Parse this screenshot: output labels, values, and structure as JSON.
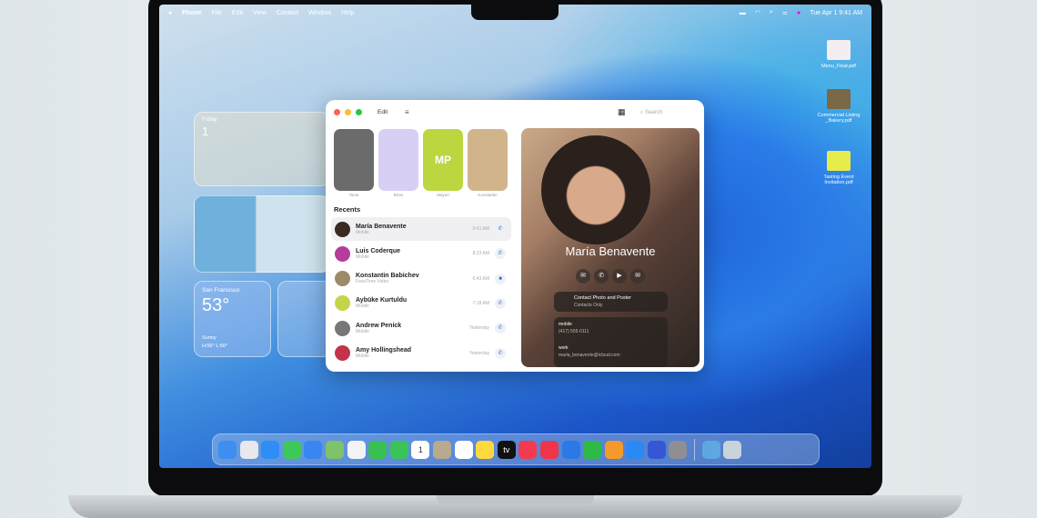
{
  "menubar": {
    "apple": "",
    "app": "Phone",
    "items": [
      "File",
      "Edit",
      "View",
      "Contact",
      "Window",
      "Help"
    ],
    "datetime": "Tue Apr 1  9:41 AM"
  },
  "widgets": {
    "calendar_day": "Friday",
    "calendar_date": "1",
    "weather_city": "San Francisco",
    "weather_temp": "53°",
    "weather_cond": "Sunny",
    "weather_range": "H:56° L:50°"
  },
  "desktop_files": [
    "Menu_Final.pdf",
    "Commercial Listing _Bakery.pdf",
    "Tasting Event Invitation.pdf"
  ],
  "phone": {
    "edit_label": "Edit",
    "search_placeholder": "Search",
    "favorites": [
      {
        "name": "Tania",
        "initials": "",
        "color": "#6b6b6b"
      },
      {
        "name": "Brian",
        "initials": "",
        "color": "#d9cff5"
      },
      {
        "name": "Mayuri",
        "initials": "MP",
        "color": "#bcd640"
      },
      {
        "name": "Konstantin",
        "initials": "",
        "color": "#d2b48c"
      }
    ],
    "recents_title": "Recents",
    "recents": [
      {
        "name": "María Benavente",
        "type": "Mobile",
        "time": "9:41 AM",
        "call": "phone",
        "color": "#3a2a22"
      },
      {
        "name": "Luis Coderque",
        "type": "Mobile",
        "time": "8:23 AM",
        "call": "phone",
        "color": "#b53d9a"
      },
      {
        "name": "Konstantin Babichev",
        "type": "FaceTime Video",
        "time": "6:43 AM",
        "call": "video",
        "color": "#9d8a6a"
      },
      {
        "name": "Aybüke Kurtuldu",
        "type": "Mobile",
        "time": "7:18 AM",
        "call": "phone",
        "color": "#c6d34a"
      },
      {
        "name": "Andrew Penick",
        "type": "Mobile",
        "time": "Yesterday",
        "call": "phone",
        "color": "#777"
      },
      {
        "name": "Amy Hollingshead",
        "type": "Mobile",
        "time": "Yesterday",
        "call": "phone",
        "color": "#c2344a"
      }
    ],
    "detail": {
      "name": "María Benavente",
      "poster_title": "Contact Photo and Poster",
      "poster_sub": "Contacts Only",
      "mobile_label": "mobile",
      "mobile": "(417) 555-0111",
      "work_label": "work",
      "email": "maria_benavente@icloud.com"
    }
  },
  "dock": [
    {
      "name": "Finder",
      "color": "#3d8ef0"
    },
    {
      "name": "Launchpad",
      "color": "#e8e8ee"
    },
    {
      "name": "Safari",
      "color": "#2f8ef5"
    },
    {
      "name": "Messages",
      "color": "#3fc85a"
    },
    {
      "name": "Mail",
      "color": "#3a86f0"
    },
    {
      "name": "Maps",
      "color": "#7fc26a"
    },
    {
      "name": "Photos",
      "color": "#f3f3f3"
    },
    {
      "name": "FaceTime",
      "color": "#38c152"
    },
    {
      "name": "Phone",
      "color": "#3ac458"
    },
    {
      "name": "Calendar",
      "color": "#ffffff"
    },
    {
      "name": "Contacts",
      "color": "#b9a98f"
    },
    {
      "name": "Reminders",
      "color": "#ffffff"
    },
    {
      "name": "Notes",
      "color": "#ffd93d"
    },
    {
      "name": "TV",
      "color": "#111111"
    },
    {
      "name": "Music",
      "color": "#f23b4e"
    },
    {
      "name": "News",
      "color": "#f0354a"
    },
    {
      "name": "Keynote",
      "color": "#2a79e6"
    },
    {
      "name": "Numbers",
      "color": "#2dbb46"
    },
    {
      "name": "Pages",
      "color": "#f59a2a"
    },
    {
      "name": "App Store",
      "color": "#2a8af5"
    },
    {
      "name": "iPhone Mirroring",
      "color": "#3557d6"
    },
    {
      "name": "System Settings",
      "color": "#8e8e93"
    },
    {
      "name": "Downloads",
      "color": "#5ea7e0"
    },
    {
      "name": "Trash",
      "color": "#c8d3dc"
    }
  ],
  "dock_glyphs": {
    "TV": "tv",
    "Calendar": "1"
  }
}
